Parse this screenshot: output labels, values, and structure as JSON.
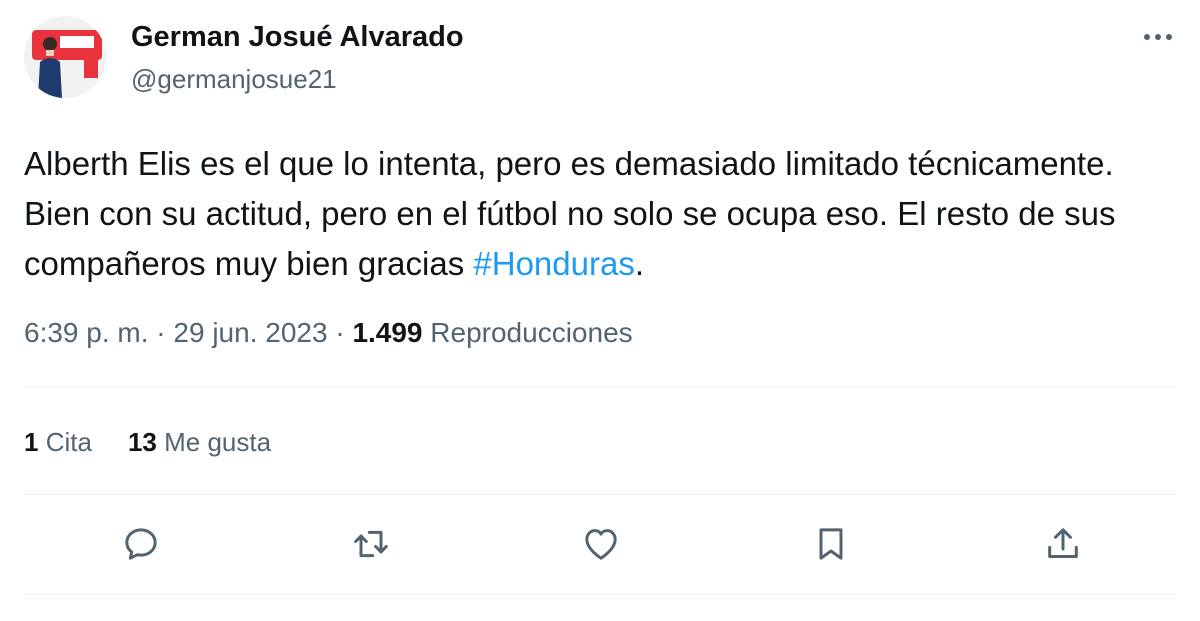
{
  "author": {
    "display_name": "German Josué Alvarado",
    "handle": "@germanjosue21"
  },
  "tweet": {
    "text_before_hashtag": "Alberth Elis es el que lo intenta, pero es demasiado limitado técnicamente. Bien con su actitud, pero en el fútbol no solo se ocupa eso. El resto de sus compañeros muy bien gracias ",
    "hashtag": "#Honduras",
    "text_after_hashtag": "."
  },
  "meta": {
    "time": "6:39 p. m.",
    "separator": " · ",
    "date": "29 jun. 2023",
    "views_count": "1.499",
    "views_label": "Reproducciones"
  },
  "stats": {
    "quotes_count": "1",
    "quotes_label": "Cita",
    "likes_count": "13",
    "likes_label": "Me gusta"
  },
  "actions": [
    {
      "name": "reply",
      "icon": "reply-icon"
    },
    {
      "name": "retweet",
      "icon": "retweet-icon"
    },
    {
      "name": "like",
      "icon": "heart-icon"
    },
    {
      "name": "bookmark",
      "icon": "bookmark-icon"
    },
    {
      "name": "share",
      "icon": "share-icon"
    }
  ],
  "colors": {
    "text_primary": "#0f1419",
    "text_secondary": "#536471",
    "link": "#1d9bf0",
    "divider": "#eff3f4"
  }
}
